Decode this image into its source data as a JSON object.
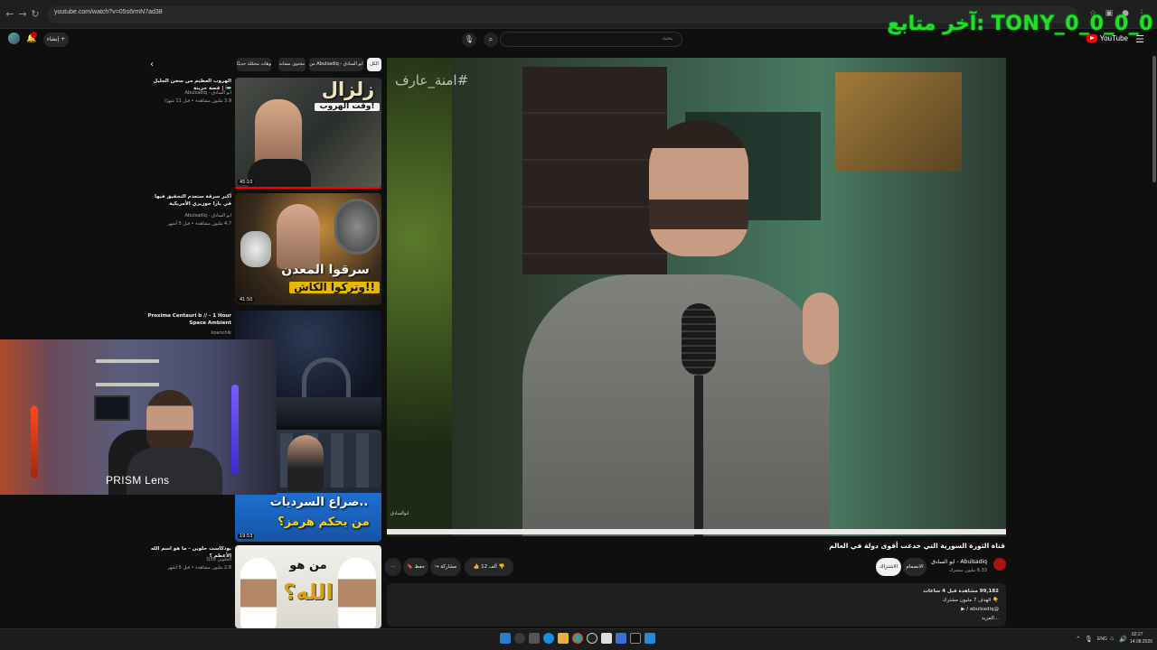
{
  "browser": {
    "url": "youtube.com/watch?v=05s6rmN7ad38"
  },
  "overlay": {
    "text": "آخر متابع: TONY_0_0_0_0"
  },
  "masthead": {
    "logo_text": "YouTube",
    "search_placeholder": "بحث",
    "create_label": "إنشاء"
  },
  "chips": [
    {
      "label": "الكل",
      "active": true
    },
    {
      "label": "من Abulsadiq - ابو السادق",
      "active": false
    },
    {
      "label": "محتوى مشابه",
      "active": false
    },
    {
      "label": "فيديوهات محمّلة حديثًا",
      "active": false
    }
  ],
  "recommendations": [
    {
      "title": "الهروب العظيم من سجن الجليل 🇵🇸 | قصة حزينة",
      "channel": "ابو السادق - Abulsadiq",
      "meta": "3.9 مليون مشاهدة • قبل 11 شهرًا",
      "duration": "45:10",
      "thumb_line1": "زلزال",
      "thumb_line2": "وقت الهروب!"
    },
    {
      "title": "أكبر سرقة ستعدم التحقيق فيها في بارا جوزيري الأمريكية",
      "channel": "ابو السادق - Abulsadiq",
      "meta": "4.7 مليون مشاهدة • قبل 5 أشهر",
      "duration": "41:50",
      "thumb_line1": "سرقوا المعدن",
      "thumb_line2": "وتركوا الكاش!!"
    },
    {
      "title": "Proxima Centauri b // - 1 Hour Space Ambient",
      "channel": "koanchik",
      "meta": "",
      "duration": ""
    },
    {
      "title": "",
      "channel": "",
      "meta": "",
      "duration": "19:53",
      "thumb_line1": "صراع السرديات..",
      "thumb_line2": "من يحكم هرمز؟"
    },
    {
      "title": "بودكاست حلوين - ما هو اسم الله الأعظم ؟",
      "channel": "الحلوين Q30",
      "meta": "2.8 مليون مشاهدة • قبل 5 أشهر",
      "duration": "",
      "thumb_line1": "من هو",
      "thumb_line2": "الله؟"
    }
  ],
  "webcam": {
    "label": "PRISM Lens"
  },
  "player": {
    "hashtag": "#امنة_عارف",
    "watermark": "ابوالسادق"
  },
  "watch": {
    "title": "قناة الثورة السورية التي خدعت أقوى دولة في العالم",
    "channel": "Abulsadiq - ابو السادق",
    "subscribers": "6.33 مليون مشترك",
    "join_label": "الانضمام",
    "subscribe_label": "الاشتراك",
    "like_count": "12 ألف",
    "share_label": "مشاركة",
    "save_label": "حفظ",
    "description": {
      "line1": "99,182 مشاهدة قبل 4 ساعات",
      "line2": "👇 الهدف 7 مليون مشترك",
      "line3": "@abulsadiq / ▶",
      "line4": "...المزيد"
    }
  },
  "taskbar": {
    "lang": "ENG",
    "time": "02:27",
    "date": "14.08.2026"
  },
  "colors": {
    "overlay_green": "#21e021",
    "yt_red": "#ff0000",
    "background": "#0f0f0f"
  }
}
